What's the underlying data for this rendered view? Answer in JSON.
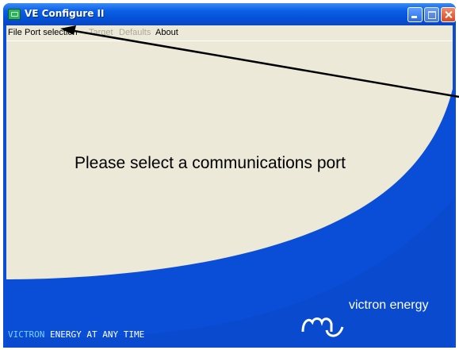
{
  "window": {
    "title": "VE Configure II"
  },
  "menu": {
    "file": "File",
    "port_selection": "Port selection",
    "target": "Target",
    "defaults": "Defaults",
    "about": "About"
  },
  "main": {
    "prompt": "Please select a communications port"
  },
  "branding": {
    "tagline_part1": "VICTRON",
    "tagline_part2": "ENERGY AT ANY TIME",
    "brand_name": "victron energy"
  },
  "colors": {
    "brand_blue": "#0a4ed8",
    "panel_bg": "#ece9d8",
    "disabled_text": "#aca899"
  }
}
